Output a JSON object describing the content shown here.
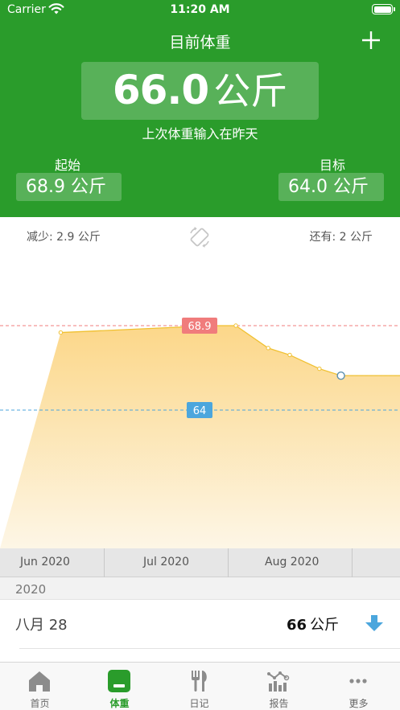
{
  "status_bar": {
    "carrier": "Carrier",
    "time": "11:20 AM"
  },
  "header": {
    "title": "目前体重",
    "current_value": "66.0",
    "current_unit": "公斤",
    "last_entry_note": "上次体重输入在昨天",
    "start_label": "起始",
    "start_value": "68.9 公斤",
    "goal_label": "目标",
    "goal_value": "64.0 公斤"
  },
  "summary": {
    "loss": "减少: 2.9 公斤",
    "remaining": "还有: 2 公斤"
  },
  "chart_data": {
    "type": "area",
    "x_axis_labels": [
      "Jun 2020",
      "Jul 2020",
      "Aug 2020"
    ],
    "start_line_label": "68.9",
    "start_line_value": 68.9,
    "goal_line_label": "64",
    "goal_line_value": 64,
    "points": [
      {
        "x": "2020-05-15",
        "y": 68.5
      },
      {
        "x": "2020-07-10",
        "y": 68.9
      },
      {
        "x": "2020-07-19",
        "y": 68.9
      },
      {
        "x": "2020-07-31",
        "y": 67.6
      },
      {
        "x": "2020-08-08",
        "y": 67.2
      },
      {
        "x": "2020-08-19",
        "y": 66.4
      },
      {
        "x": "2020-08-27",
        "y": 66.0
      }
    ],
    "ylim": [
      60,
      72
    ],
    "colors": {
      "line": "#f0c030",
      "fill_top": "#fcd789",
      "start_line": "#f07c7c",
      "goal_line": "#4ba6dd"
    }
  },
  "list": {
    "year": "2020",
    "entries": [
      {
        "date": "八月 28",
        "weight": "66",
        "unit": "公斤",
        "trend": "down-arrow-icon"
      }
    ]
  },
  "tabs": [
    {
      "label": "首页",
      "icon": "home-icon",
      "active": false
    },
    {
      "label": "体重",
      "icon": "scale-icon",
      "active": true
    },
    {
      "label": "日记",
      "icon": "utensils-icon",
      "active": false
    },
    {
      "label": "报告",
      "icon": "report-chart-icon",
      "active": false
    },
    {
      "label": "更多",
      "icon": "more-icon",
      "active": false
    }
  ],
  "colors": {
    "brand_green": "#2a9c2b",
    "accent_blue": "#4ba6dd"
  }
}
